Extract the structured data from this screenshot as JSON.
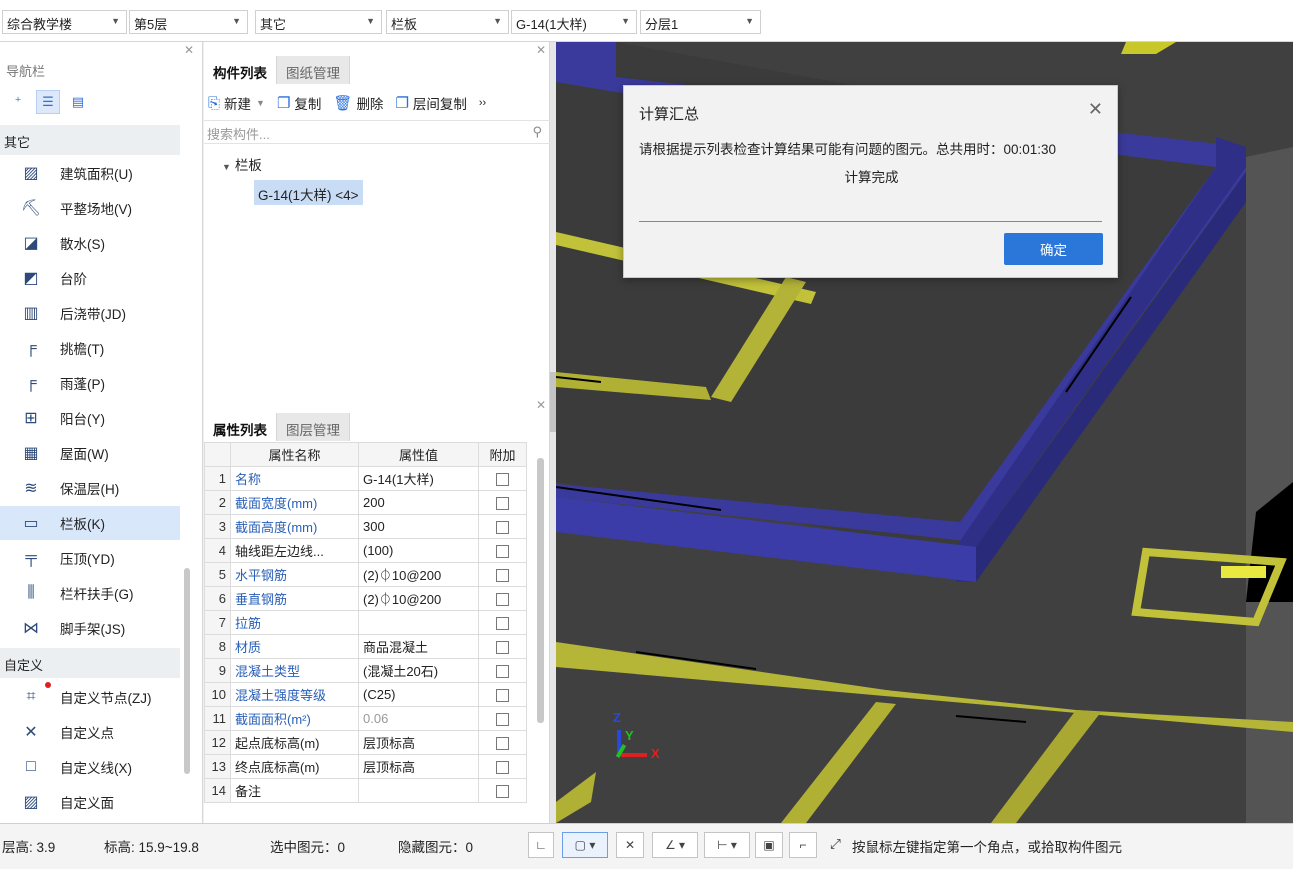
{
  "topbar": {
    "building": "综合教学楼",
    "floor": "第5层",
    "category": "其它",
    "type": "栏板",
    "element": "G-14(1大样)",
    "sublayer": "分层1"
  },
  "nav": {
    "title": "导航栏",
    "groups": [
      {
        "label": "其它",
        "items": [
          "建筑面积(U)",
          "平整场地(V)",
          "散水(S)",
          "台阶",
          "后浇带(JD)",
          "挑檐(T)",
          "雨蓬(P)",
          "阳台(Y)",
          "屋面(W)",
          "保温层(H)",
          "栏板(K)",
          "压顶(YD)",
          "栏杆扶手(G)",
          "脚手架(JS)"
        ]
      },
      {
        "label": "自定义",
        "items": [
          "自定义节点(ZJ)",
          "自定义点",
          "自定义线(X)",
          "自定义面"
        ]
      }
    ],
    "selected": "栏板(K)"
  },
  "component_panel": {
    "tabs": [
      "构件列表",
      "图纸管理"
    ],
    "tools": [
      "新建",
      "复制",
      "删除",
      "层间复制"
    ],
    "more": "››",
    "search_placeholder": "搜索构件...",
    "tree_root": "栏板",
    "tree_item": "G-14(1大样) <4>"
  },
  "property_panel": {
    "tabs": [
      "属性列表",
      "图层管理"
    ],
    "headers": [
      "属性名称",
      "属性值",
      "附加"
    ],
    "rows": [
      {
        "n": "1",
        "name": "名称",
        "value": "G-14(1大样)",
        "link": true
      },
      {
        "n": "2",
        "name": "截面宽度(mm)",
        "value": "200",
        "link": true
      },
      {
        "n": "3",
        "name": "截面高度(mm)",
        "value": "300",
        "link": true
      },
      {
        "n": "4",
        "name": "轴线距左边线...",
        "value": "(100)",
        "link": false
      },
      {
        "n": "5",
        "name": "水平钢筋",
        "value": "(2)⏀10@200",
        "link": true
      },
      {
        "n": "6",
        "name": "垂直钢筋",
        "value": "(2)⏀10@200",
        "link": true
      },
      {
        "n": "7",
        "name": "拉筋",
        "value": "",
        "link": true
      },
      {
        "n": "8",
        "name": "材质",
        "value": "商品混凝土",
        "link": true
      },
      {
        "n": "9",
        "name": "混凝土类型",
        "value": "(混凝土20石)",
        "link": true
      },
      {
        "n": "10",
        "name": "混凝土强度等级",
        "value": "(C25)",
        "link": true
      },
      {
        "n": "11",
        "name": "截面面积(m²)",
        "value": "0.06",
        "link": true
      },
      {
        "n": "12",
        "name": "起点底标高(m)",
        "value": "层顶标高",
        "link": false
      },
      {
        "n": "13",
        "name": "终点底标高(m)",
        "value": "层顶标高",
        "link": false
      },
      {
        "n": "14",
        "name": "备注",
        "value": "",
        "link": false
      }
    ]
  },
  "dialog": {
    "title": "计算汇总",
    "message": "请根据提示列表检查计算结果可能有问题的图元。总共用时：00:01:30",
    "status": "计算完成",
    "ok": "确定"
  },
  "status": {
    "floor_height": "层高:  3.9",
    "elevation": "标高:  15.9~19.8",
    "selected": "选中图元：0",
    "hidden": "隐藏图元：0",
    "hint": "按鼠标左键指定第一个角点，或拾取构件图元"
  },
  "axis": {
    "x": "X",
    "y": "Y",
    "z": "Z"
  }
}
